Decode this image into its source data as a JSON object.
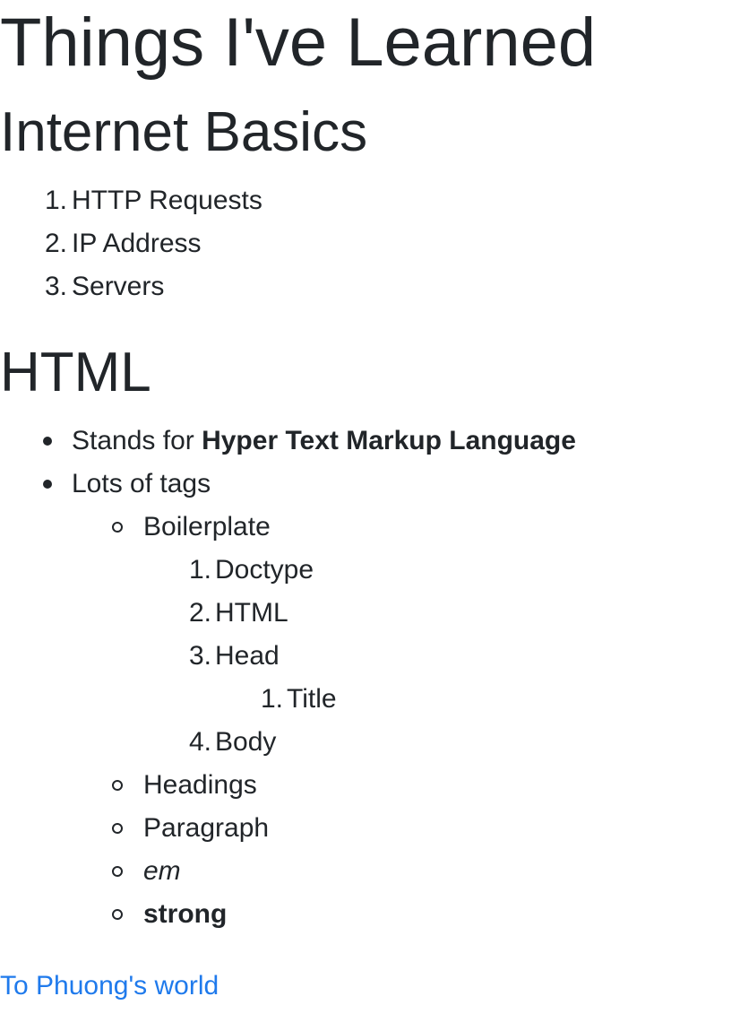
{
  "page": {
    "title": "Things I've Learned",
    "link_label": "To Phuong's world"
  },
  "internet_basics": {
    "heading": "Internet Basics",
    "items": [
      {
        "marker": "1.",
        "label": "HTTP Requests"
      },
      {
        "marker": "2.",
        "label": "IP Address"
      },
      {
        "marker": "3.",
        "label": "Servers"
      }
    ]
  },
  "html": {
    "heading": "HTML",
    "stands_for_prefix": "Stands for ",
    "stands_for_strong": "Hyper Text Markup Language",
    "lots_of_tags": "Lots of tags",
    "tags": {
      "boilerplate": "Boilerplate",
      "boilerplate_items": [
        {
          "marker": "1.",
          "label": "Doctype"
        },
        {
          "marker": "2.",
          "label": "HTML"
        },
        {
          "marker": "3.",
          "label": "Head"
        },
        {
          "marker": "4.",
          "label": "Body"
        }
      ],
      "head_child": {
        "marker": "1.",
        "label": "Title"
      },
      "headings": "Headings",
      "paragraph": "Paragraph",
      "em": "em",
      "strong": "strong"
    }
  }
}
